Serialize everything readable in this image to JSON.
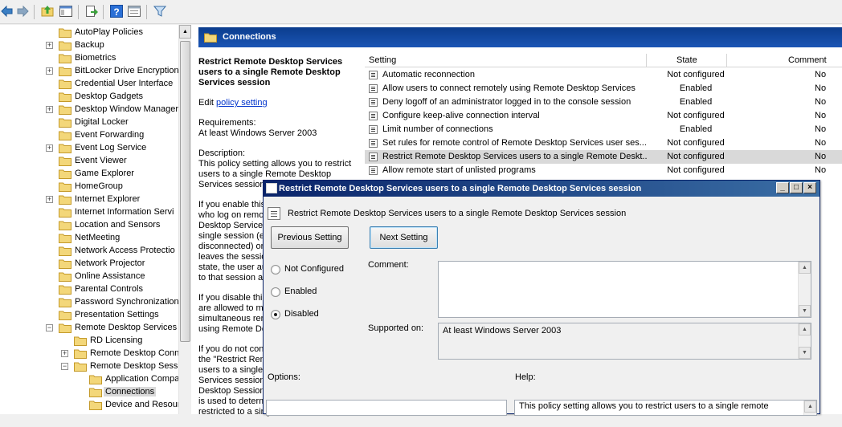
{
  "toolbar": {
    "icons": [
      "back-icon",
      "forward-icon",
      "up-icon",
      "show-hide-tree-icon",
      "export-icon",
      "help-icon",
      "properties-icon",
      "filter-icon"
    ]
  },
  "tree": {
    "items": [
      {
        "label": "AutoPlay Policies",
        "expander": false
      },
      {
        "label": "Backup",
        "expander": true
      },
      {
        "label": "Biometrics",
        "expander": false
      },
      {
        "label": "BitLocker Drive Encryption",
        "expander": true
      },
      {
        "label": "Credential User Interface",
        "expander": false
      },
      {
        "label": "Desktop Gadgets",
        "expander": false
      },
      {
        "label": "Desktop Window Manager",
        "expander": true
      },
      {
        "label": "Digital Locker",
        "expander": false
      },
      {
        "label": "Event Forwarding",
        "expander": false
      },
      {
        "label": "Event Log Service",
        "expander": true
      },
      {
        "label": "Event Viewer",
        "expander": false
      },
      {
        "label": "Game Explorer",
        "expander": false
      },
      {
        "label": "HomeGroup",
        "expander": false
      },
      {
        "label": "Internet Explorer",
        "expander": true
      },
      {
        "label": "Internet Information Servi",
        "expander": false
      },
      {
        "label": "Location and Sensors",
        "expander": false
      },
      {
        "label": "NetMeeting",
        "expander": false
      },
      {
        "label": "Network Access Protectio",
        "expander": false
      },
      {
        "label": "Network Projector",
        "expander": false
      },
      {
        "label": "Online Assistance",
        "expander": false
      },
      {
        "label": "Parental Controls",
        "expander": false
      },
      {
        "label": "Password Synchronization",
        "expander": false
      },
      {
        "label": "Presentation Settings",
        "expander": false
      },
      {
        "label": "Remote Desktop Services",
        "expander": "minus"
      },
      {
        "label": "RD Licensing",
        "expander": false
      },
      {
        "label": "Remote Desktop Conn",
        "expander": true
      },
      {
        "label": "Remote Desktop Sessi",
        "expander": "minus"
      },
      {
        "label": "Application Compa",
        "expander": false
      },
      {
        "label": "Connections",
        "expander": false,
        "selected": true
      },
      {
        "label": "Device and Resour",
        "expander": false
      }
    ]
  },
  "right_pane": {
    "header": "Connections",
    "description": {
      "title": "Restrict Remote Desktop Services users to a single Remote Desktop Services session",
      "edit_prefix": "Edit ",
      "edit_link": "policy setting ",
      "requirements_label": "Requirements:",
      "requirements_value": "At least Windows Server 2003",
      "description_label": "Description:",
      "description_text": "This policy setting allows you to restrict users to a single Remote Desktop Services session.",
      "para2": "If you enable this policy setting, users who log on remotely by using Remote Desktop Services will be restricted to a single session (either active or disconnected) on that server. If the user leaves the session in a disconnected state, the user automatically reconnects to that session at the next logon.",
      "para3": "If you disable this policy setting, users are allowed to make unlimited simultaneous remote connections by using Remote Desktop Services.",
      "para4": "If you do not configure this policy setting, the \"Restrict Remote Desktop Services users to a single Remote Desktop Services session\" setting in the Remote Desktop Session Host Configuration tool is used to determine if users are restricted to a single Remote D"
    },
    "table": {
      "headers": {
        "setting": "Setting",
        "state": "State",
        "comment": "Comment"
      },
      "rows": [
        {
          "name": "Automatic reconnection",
          "state": "Not configured",
          "comment": "No"
        },
        {
          "name": "Allow users to connect remotely using Remote Desktop Services",
          "state": "Enabled",
          "comment": "No"
        },
        {
          "name": "Deny logoff of an administrator logged in to the console session",
          "state": "Enabled",
          "comment": "No"
        },
        {
          "name": "Configure keep-alive connection interval",
          "state": "Not configured",
          "comment": "No"
        },
        {
          "name": "Limit number of connections",
          "state": "Enabled",
          "comment": "No"
        },
        {
          "name": "Set rules for remote control of Remote Desktop Services user ses...",
          "state": "Not configured",
          "comment": "No"
        },
        {
          "name": "Restrict Remote Desktop Services users to a single Remote Deskt...",
          "state": "Not configured",
          "comment": "No",
          "selected": true
        },
        {
          "name": "Allow remote start of unlisted programs",
          "state": "Not configured",
          "comment": "No"
        }
      ]
    }
  },
  "dialog": {
    "title": "Restrict Remote Desktop Services users to a single Remote Desktop Services session",
    "heading": "Restrict Remote Desktop Services users to a single Remote Desktop Services session",
    "prev_button": "Previous Setting",
    "next_button": "Next Setting",
    "radio_not_configured": "Not Configured",
    "radio_enabled": "Enabled",
    "radio_disabled": "Disabled",
    "selected_option": "Disabled",
    "comment_label": "Comment:",
    "comment_value": "",
    "supported_label": "Supported on:",
    "supported_value": "At least Windows Server 2003",
    "options_label": "Options:",
    "help_label": "Help:",
    "help_text": "This policy setting allows you to restrict users to a single remote"
  }
}
